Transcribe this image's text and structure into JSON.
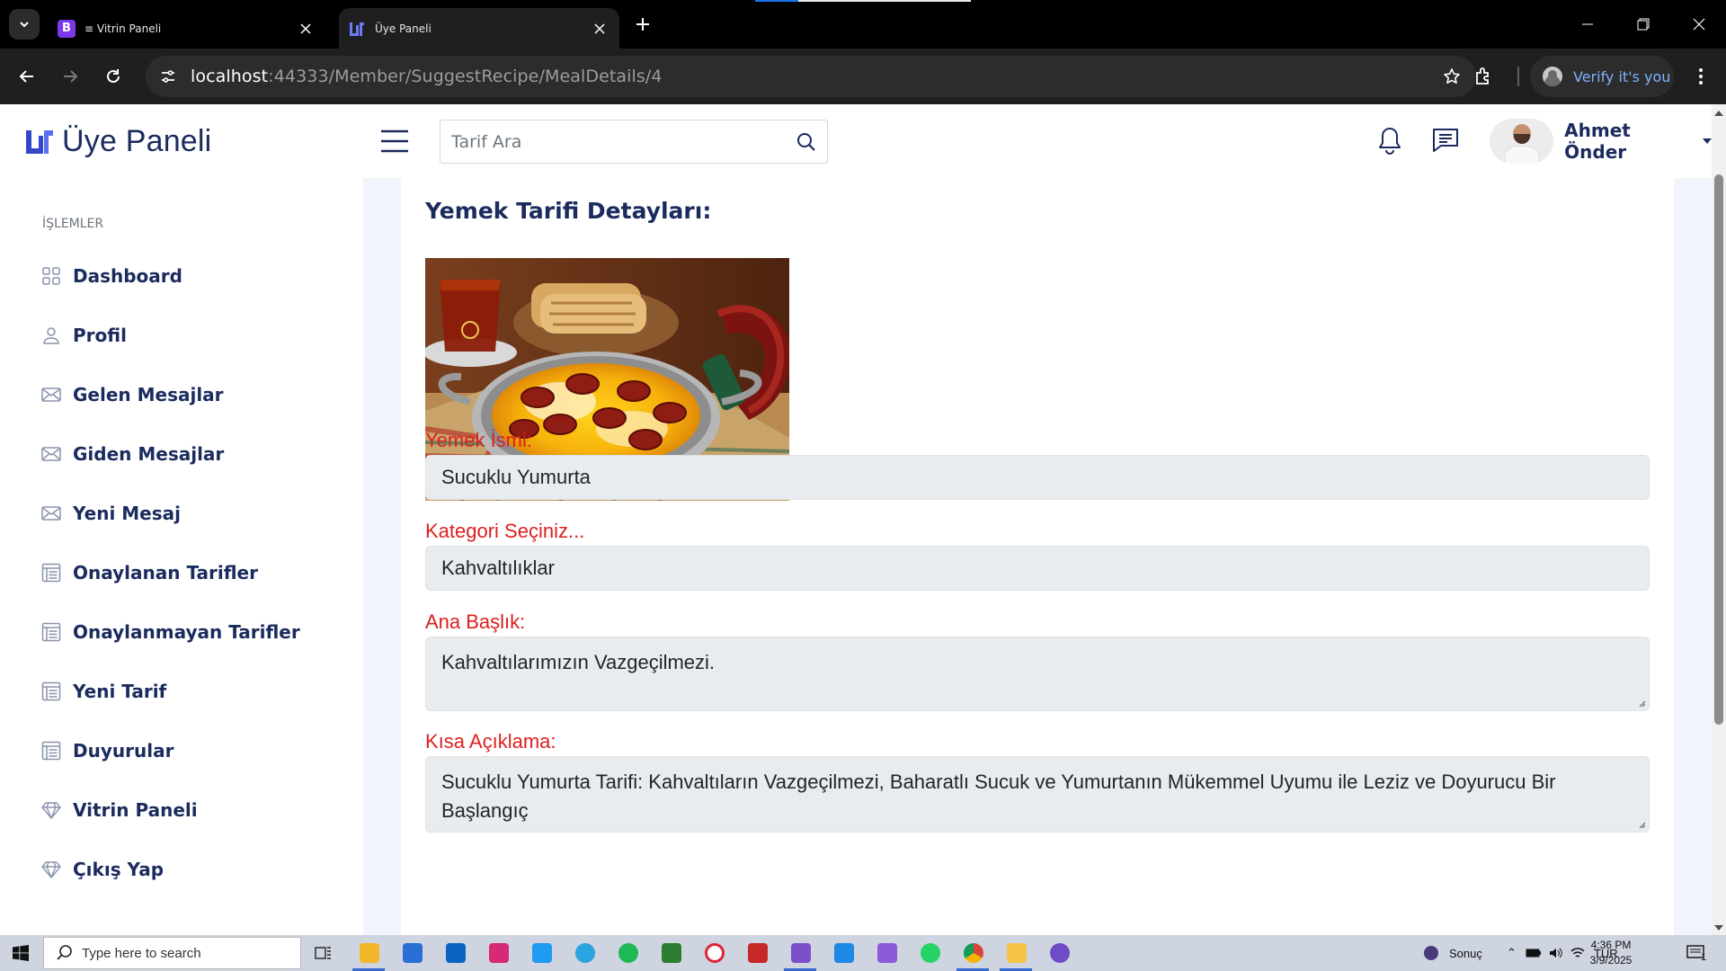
{
  "browser": {
    "tabs": [
      {
        "title": "≡ Vitrin Paneli",
        "favicon": "bootstrap-icon",
        "color": "#7c3aed"
      },
      {
        "title": "Üye Paneli",
        "favicon": "site-logo-icon",
        "color": "#4f5bd5"
      }
    ],
    "url_host": "localhost",
    "url_rest": ":44333/Member/SuggestRecipe/MealDetails/4",
    "verify_label": "Verify it's you"
  },
  "header": {
    "brand": "Üye Paneli",
    "search_placeholder": "Tarif Ara",
    "user_name": "Ahmet Önder"
  },
  "sidebar": {
    "section_title": "İŞLEMLER",
    "items": [
      {
        "label": "Dashboard",
        "icon": "grid-icon"
      },
      {
        "label": "Profil",
        "icon": "user-icon"
      },
      {
        "label": "Gelen Mesajlar",
        "icon": "mail-icon"
      },
      {
        "label": "Giden Mesajlar",
        "icon": "mail-icon"
      },
      {
        "label": "Yeni Mesaj",
        "icon": "mail-icon"
      },
      {
        "label": "Onaylanan Tarifler",
        "icon": "list-icon"
      },
      {
        "label": "Onaylanmayan Tarifler",
        "icon": "list-icon"
      },
      {
        "label": "Yeni Tarif",
        "icon": "list-icon"
      },
      {
        "label": "Duyurular",
        "icon": "list-icon"
      },
      {
        "label": "Vitrin Paneli",
        "icon": "diamond-icon"
      },
      {
        "label": "Çıkış Yap",
        "icon": "diamond-icon"
      }
    ]
  },
  "main": {
    "title": "Yemek Tarifi Detayları:",
    "image_subject": "sucuklu-yumurta-photo",
    "fields": {
      "name_label": "Yemek İsmi:",
      "name_value": "Sucuklu Yumurta",
      "category_label": "Kategori Seçiniz...",
      "category_value": "Kahvaltılıklar",
      "headline_label": "Ana Başlık:",
      "headline_value": "Kahvaltılarımızın Vazgeçilmezi.",
      "summary_label": "Kısa Açıklama:",
      "summary_value": "Sucuklu Yumurta Tarifi: Kahvaltıların Vazgeçilmezi, Baharatlı Sucuk ve Yumurtanın Mükemmel Uyumu ile Leziz ve Doyurucu Bir Başlangıç"
    }
  },
  "taskbar": {
    "search_placeholder": "Type here to search",
    "weather_label": "Sonuç",
    "language": "TUR",
    "time": "4:36 PM",
    "date": "3/9/2025",
    "notification_count": "1"
  },
  "colors": {
    "accent": "#1b2b5e",
    "label_red": "#dd1f1f",
    "field_bg": "#e9ecef",
    "content_bg": "#f2f4fb"
  }
}
